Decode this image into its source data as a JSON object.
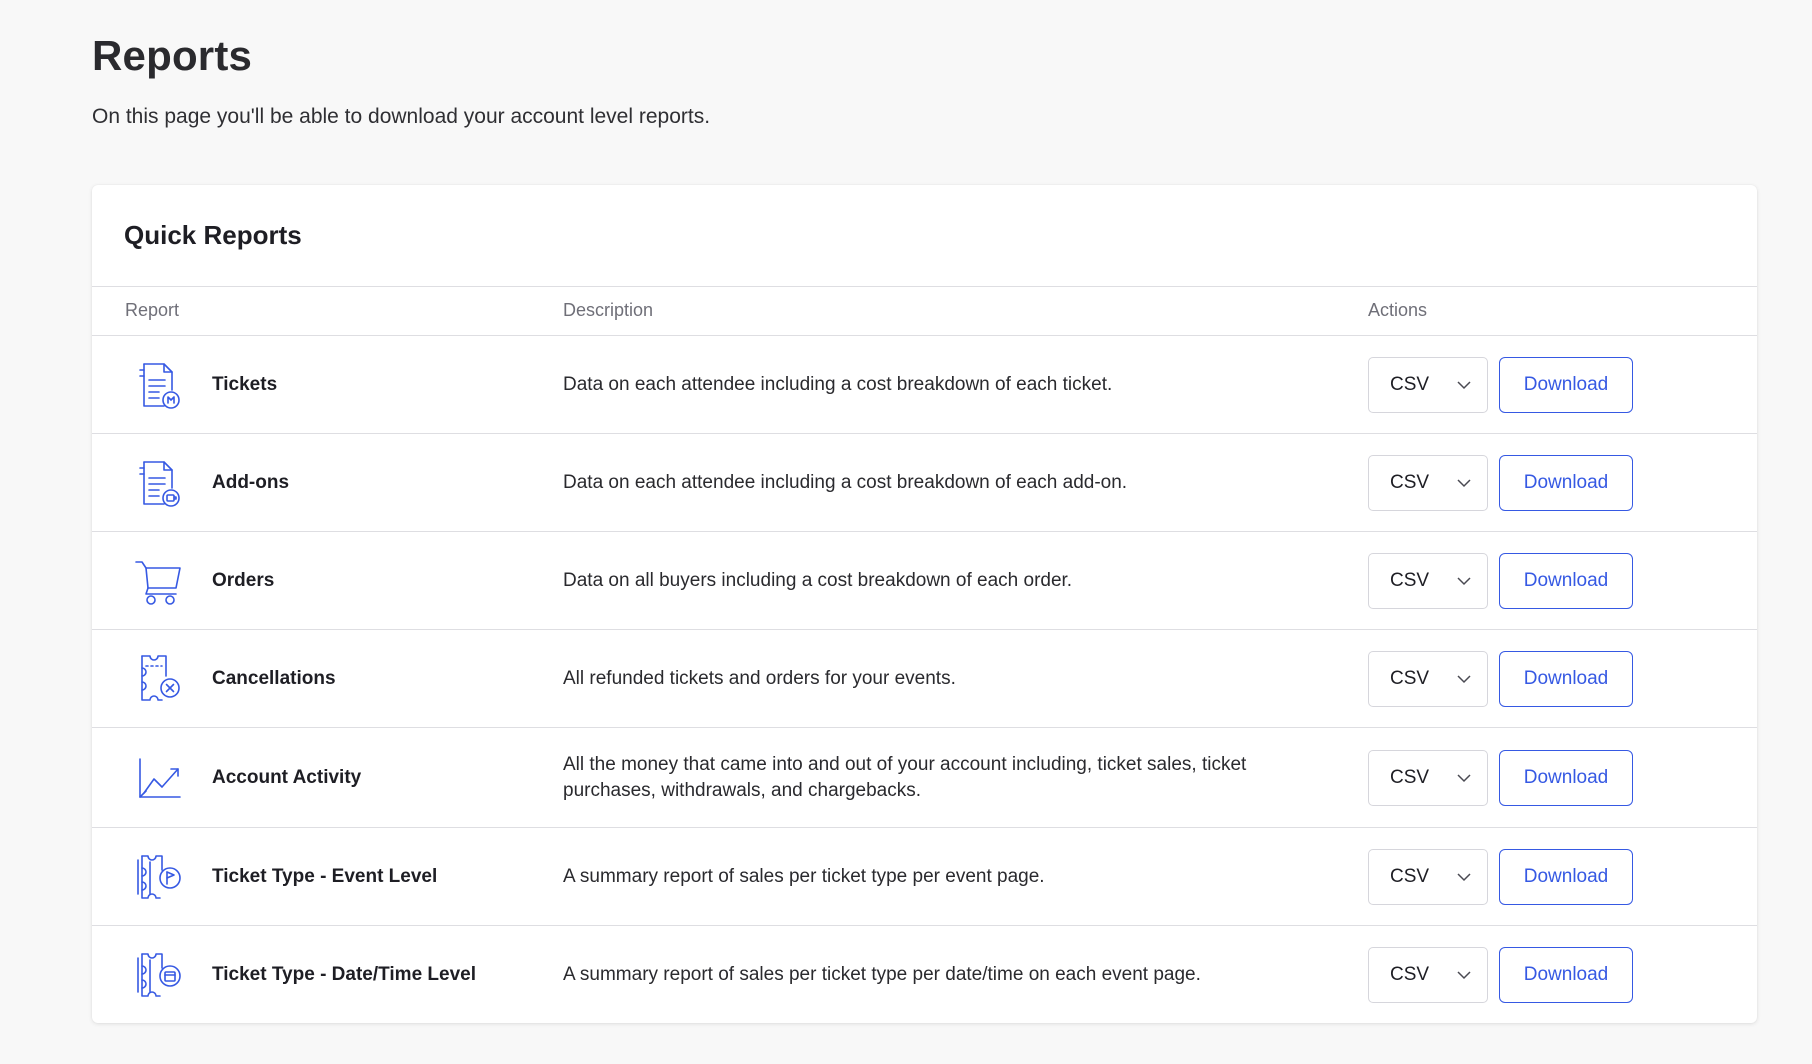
{
  "page": {
    "title": "Reports",
    "subtitle": "On this page you'll be able to download your account level reports."
  },
  "card": {
    "title": "Quick Reports",
    "columns": {
      "report": "Report",
      "description": "Description",
      "actions": "Actions"
    }
  },
  "rows": [
    {
      "name": "Tickets",
      "icon": "ticket-document-icon",
      "description": "Data on each attendee including a cost breakdown of each ticket.",
      "format": "CSV",
      "action": "Download"
    },
    {
      "name": "Add-ons",
      "icon": "addon-document-icon",
      "description": "Data on each attendee including a cost breakdown of each add-on.",
      "format": "CSV",
      "action": "Download"
    },
    {
      "name": "Orders",
      "icon": "shopping-cart-icon",
      "description": "Data on all buyers including a cost breakdown of each order.",
      "format": "CSV",
      "action": "Download"
    },
    {
      "name": "Cancellations",
      "icon": "cancelled-ticket-icon",
      "description": "All refunded tickets and orders for your events.",
      "format": "CSV",
      "action": "Download"
    },
    {
      "name": "Account Activity",
      "icon": "trend-chart-icon",
      "description": "All the money that came into and out of your account including, ticket sales, ticket purchases, withdrawals, and chargebacks.",
      "format": "CSV",
      "action": "Download"
    },
    {
      "name": "Ticket Type - Event Level",
      "icon": "ticket-flag-icon",
      "description": "A summary report of sales per ticket type per event page.",
      "format": "CSV",
      "action": "Download"
    },
    {
      "name": "Ticket Type - Date/Time Level",
      "icon": "ticket-calendar-icon",
      "description": "A summary report of sales per ticket type per date/time on each event page.",
      "format": "CSV",
      "action": "Download"
    }
  ],
  "colors": {
    "accent": "#3659e3",
    "icon": "#3659e3",
    "border": "#dedee2",
    "background": "#f8f8f8"
  }
}
